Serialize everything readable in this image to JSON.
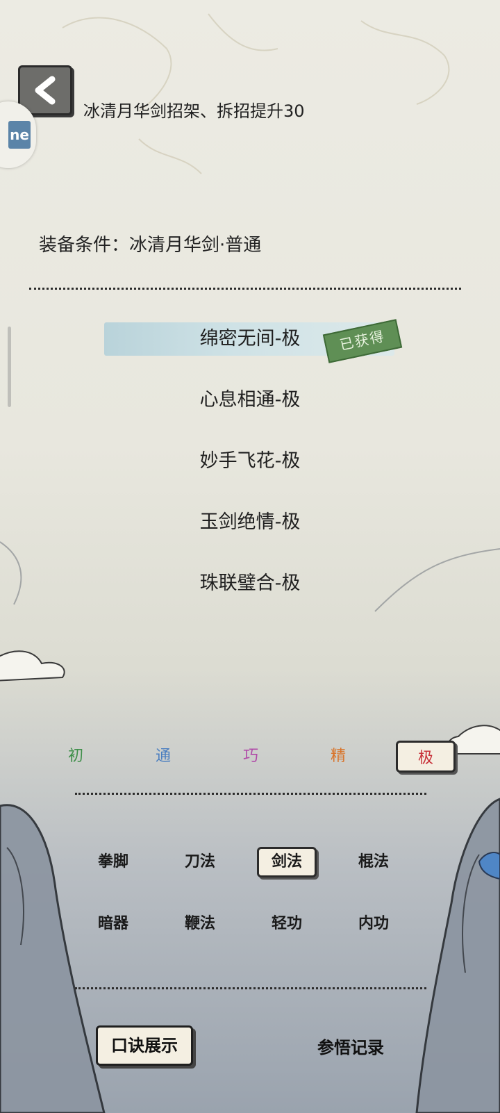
{
  "header": {
    "description": "冰清月华剑招架、拆招提升30",
    "side_tab_text": "ne"
  },
  "equip_condition": "装备条件：冰清月华剑·普通",
  "moves": [
    {
      "label": "绵密无间-极",
      "selected": true
    },
    {
      "label": "心息相通-极",
      "selected": false
    },
    {
      "label": "妙手飞花-极",
      "selected": false
    },
    {
      "label": "玉剑绝情-极",
      "selected": false
    },
    {
      "label": "珠联璧合-极",
      "selected": false
    }
  ],
  "obtained_stamp": "已获得",
  "grades": [
    {
      "label": "初",
      "color": "#3f8f4a"
    },
    {
      "label": "通",
      "color": "#4a7ec0"
    },
    {
      "label": "巧",
      "color": "#b04aa8"
    },
    {
      "label": "精",
      "color": "#d8742a"
    },
    {
      "label": "极",
      "color": "#c8323a",
      "active": true
    }
  ],
  "categories": [
    {
      "label": "拳脚"
    },
    {
      "label": "刀法"
    },
    {
      "label": "剑法",
      "active": true
    },
    {
      "label": "棍法"
    },
    {
      "label": "暗器"
    },
    {
      "label": "鞭法"
    },
    {
      "label": "轻功"
    },
    {
      "label": "内功"
    }
  ],
  "bottom": {
    "left_button": "口诀展示",
    "right_link": "参悟记录"
  }
}
